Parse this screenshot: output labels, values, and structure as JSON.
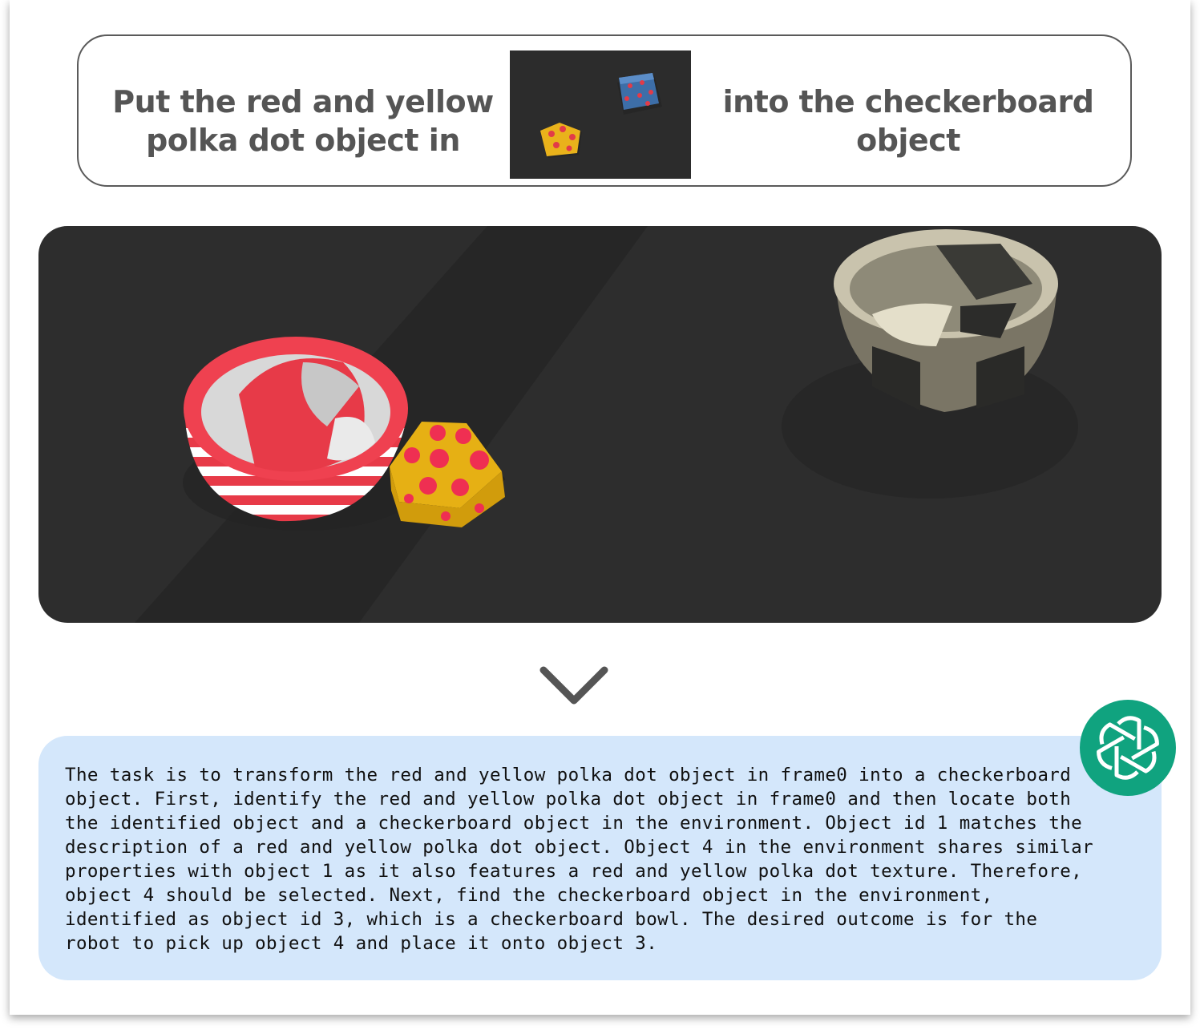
{
  "instruction": {
    "left_text": "Put the red and yellow\npolka dot object in",
    "right_text": "into the checkerboard\nobject"
  },
  "icons": {
    "down_arrow": "chevron-down-icon",
    "assistant_logo": "openai-logo-icon"
  },
  "colors": {
    "scene_background": "#2d2d2d",
    "answer_background": "#d4e7fb",
    "logo_background": "#10a37f",
    "text_gray": "#555555"
  },
  "answer": {
    "text": "The task is to transform the red and yellow polka dot object in frame0 into a checkerboard\nobject. First, identify the red and yellow polka dot object in frame0 and then locate both\nthe identified object and a checkerboard object in the environment. Object id 1 matches the\ndescription of a red and yellow polka dot object. Object 4 in the environment shares similar\nproperties with object 1 as it also features a red and yellow polka dot texture. Therefore,\nobject 4 should be selected. Next, find the checkerboard object in the environment,\nidentified as object id 3, which is a checkerboard bowl. The desired outcome is for the\nrobot to pick up object 4 and place it onto object 3."
  }
}
